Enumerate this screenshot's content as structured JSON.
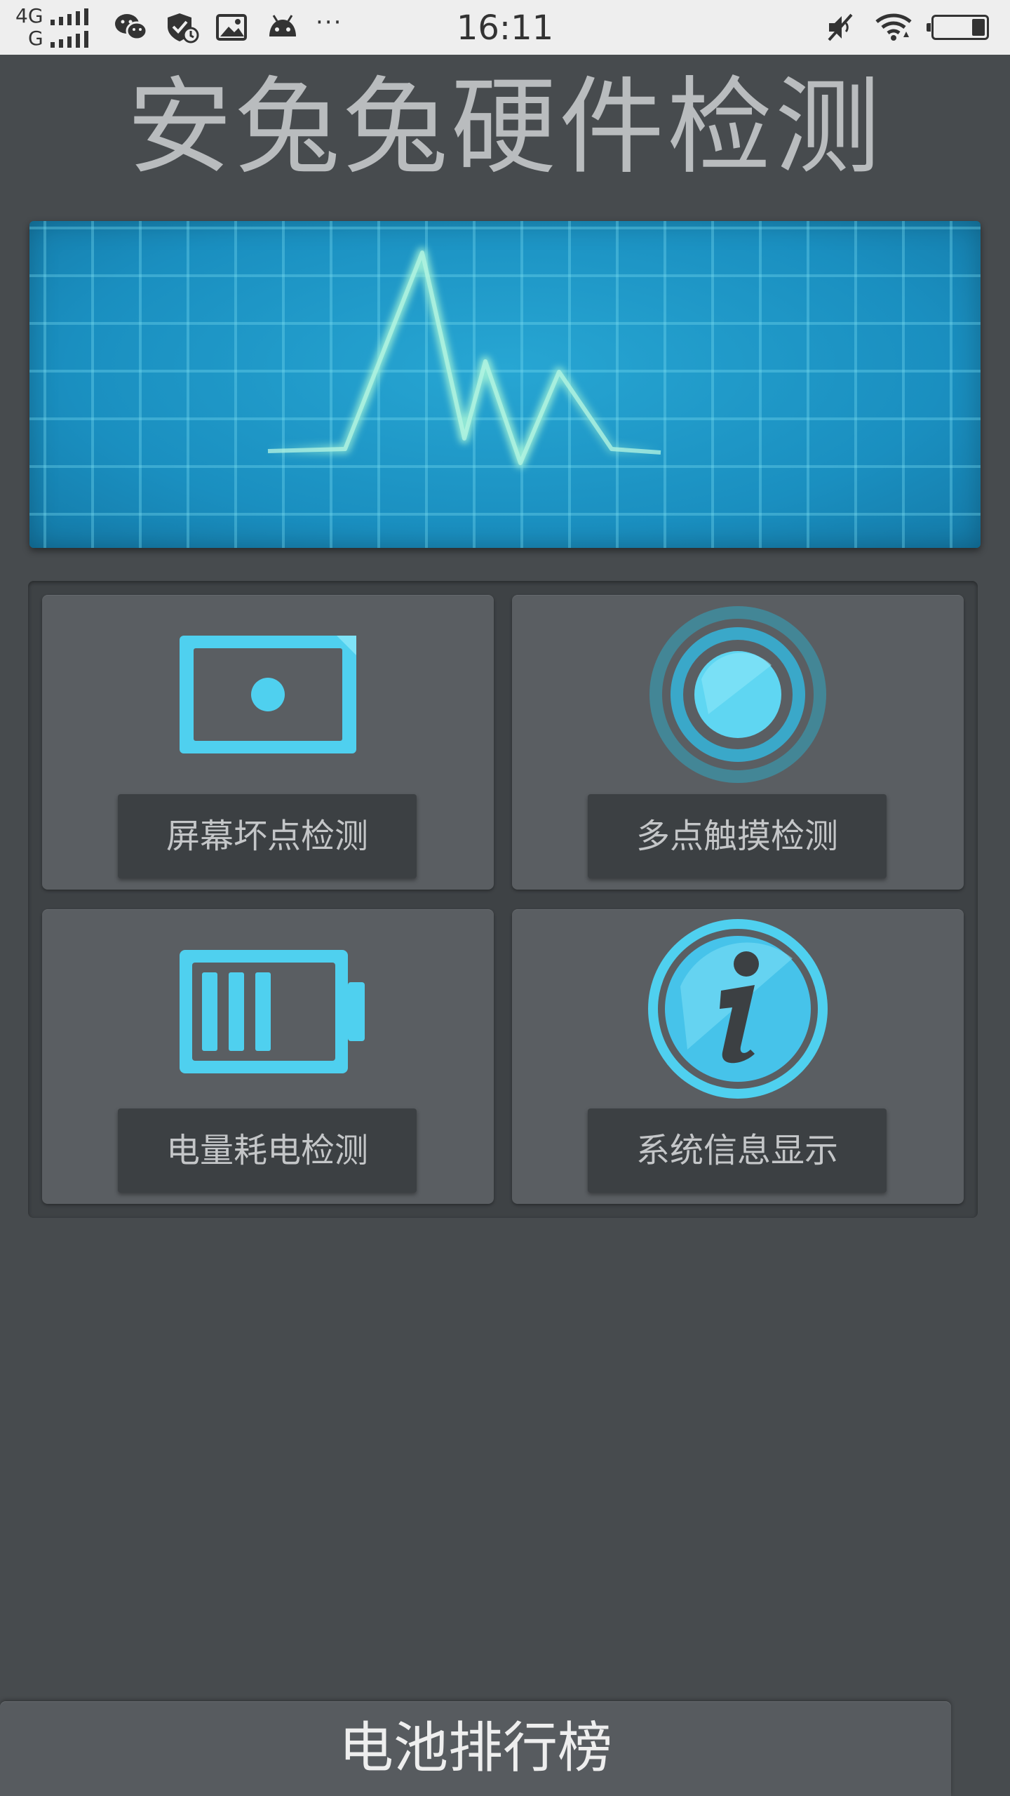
{
  "status_bar": {
    "network_top": "4G",
    "network_bottom": "G",
    "time": "16:11",
    "notification_icons": [
      "wechat-icon",
      "shield-icon",
      "image-icon",
      "android-icon"
    ],
    "more_glyph": "···",
    "right_icons": [
      "muted-icon",
      "wifi-icon",
      "battery-icon"
    ],
    "battery_level": 0.25
  },
  "app": {
    "title": "安兔兔硬件检测"
  },
  "monitor": {
    "icon": "heartbeat-waveform",
    "accent_color": "#1a8fc0",
    "wave_color": "#9ef0d6"
  },
  "tiles": [
    {
      "id": "dead-pixel",
      "label": "屏幕坏点检测",
      "icon": "screen-icon"
    },
    {
      "id": "multitouch",
      "label": "多点触摸检测",
      "icon": "touch-target-icon"
    },
    {
      "id": "battery-drain",
      "label": "电量耗电检测",
      "icon": "battery-icon"
    },
    {
      "id": "system-info",
      "label": "系统信息显示",
      "icon": "info-icon"
    }
  ],
  "footer": {
    "rank_button_label": "电池排行榜"
  },
  "colors": {
    "background": "#474b4e",
    "tile": "#5a5e62",
    "icon_cyan": "#4fd0ef",
    "title_gray": "#b9bcbe"
  }
}
